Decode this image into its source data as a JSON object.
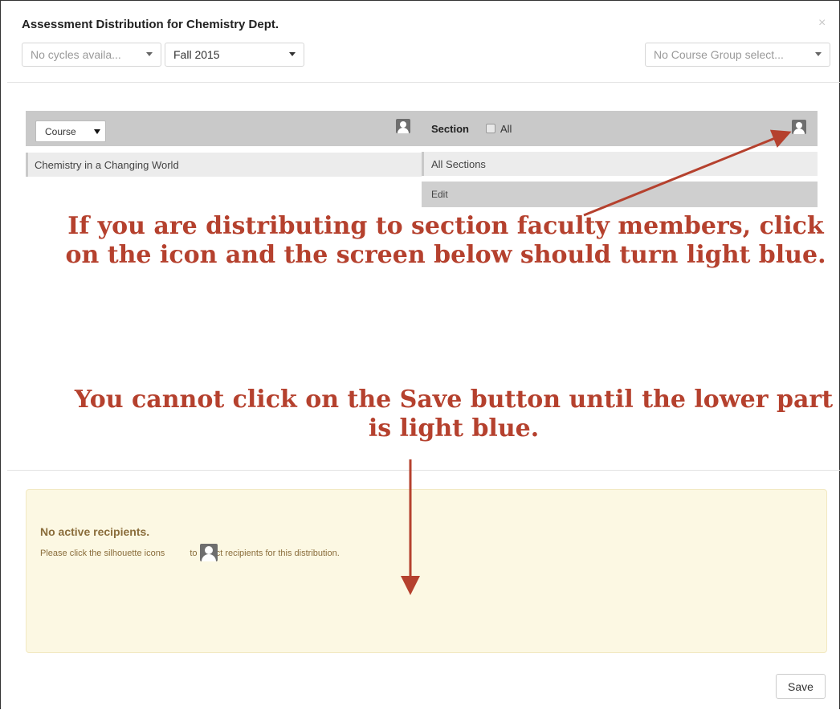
{
  "modal": {
    "title": "Assessment Distribution for Chemistry Dept.",
    "close_label": "×"
  },
  "filters": {
    "cycle_value": "No cycles availa...",
    "term_value": "Fall 2015",
    "course_group_value": "No Course Group select..."
  },
  "course_panel": {
    "dropdown_label": "Course",
    "rows": [
      "Chemistry in a Changing World"
    ]
  },
  "section_panel": {
    "header_label": "Section",
    "all_label": "All",
    "rows": [
      "All Sections",
      "Edit"
    ]
  },
  "annotations": {
    "section_icon_note": "If you are distributing to section faculty members, click on the icon and the screen below should turn light blue.",
    "save_note": "You cannot click on the Save button until the lower part is light blue."
  },
  "recipients": {
    "title": "No active recipients.",
    "text_before": "Please click the silhouette icons",
    "text_after": "to select recipients for this distribution."
  },
  "footer": {
    "save_label": "Save"
  },
  "colors": {
    "annotation": "#b5412e",
    "warning_bg": "#fcf8e3",
    "warning_text": "#8a6d3b",
    "header_bar": "#c9c9c9"
  },
  "icons": [
    "close-icon",
    "caret-down-icon",
    "person-icon",
    "checkbox-icon",
    "arrow-icon"
  ]
}
